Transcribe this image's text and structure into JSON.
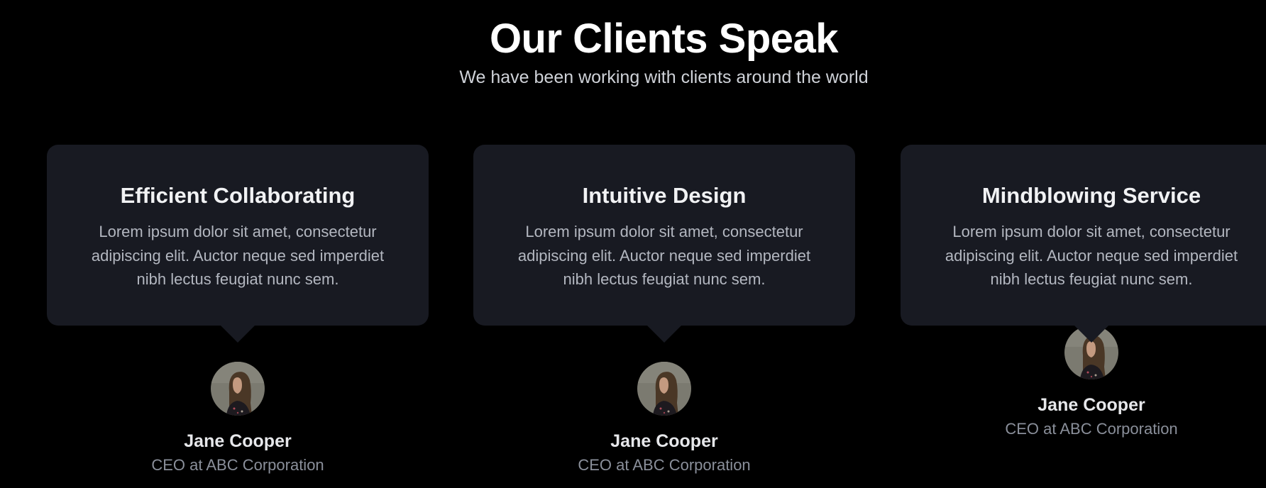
{
  "header": {
    "title": "Our Clients Speak",
    "subtitle": "We have been working with clients around the world"
  },
  "testimonials": [
    {
      "title": "Efficient Collaborating",
      "text": "Lorem ipsum dolor sit amet, consectetur adipiscing elit. Auctor neque sed imperdiet nibh lectus feugiat nunc sem.",
      "name": "Jane Cooper",
      "role": "CEO at ABC Corporation"
    },
    {
      "title": "Intuitive Design",
      "text": "Lorem ipsum dolor sit amet, consectetur adipiscing elit. Auctor neque sed imperdiet nibh lectus feugiat nunc sem.",
      "name": "Jane Cooper",
      "role": "CEO at ABC Corporation"
    },
    {
      "title": "Mindblowing Service",
      "text": "Lorem ipsum dolor sit amet, consectetur adipiscing elit. Auctor neque sed imperdiet nibh lectus feugiat nunc sem.",
      "name": "Jane Cooper",
      "role": "CEO at ABC Corporation"
    }
  ],
  "colors": {
    "background": "#000000",
    "card": "#181a22",
    "title_text": "#ffffff",
    "muted_text": "#8a8f9a"
  }
}
